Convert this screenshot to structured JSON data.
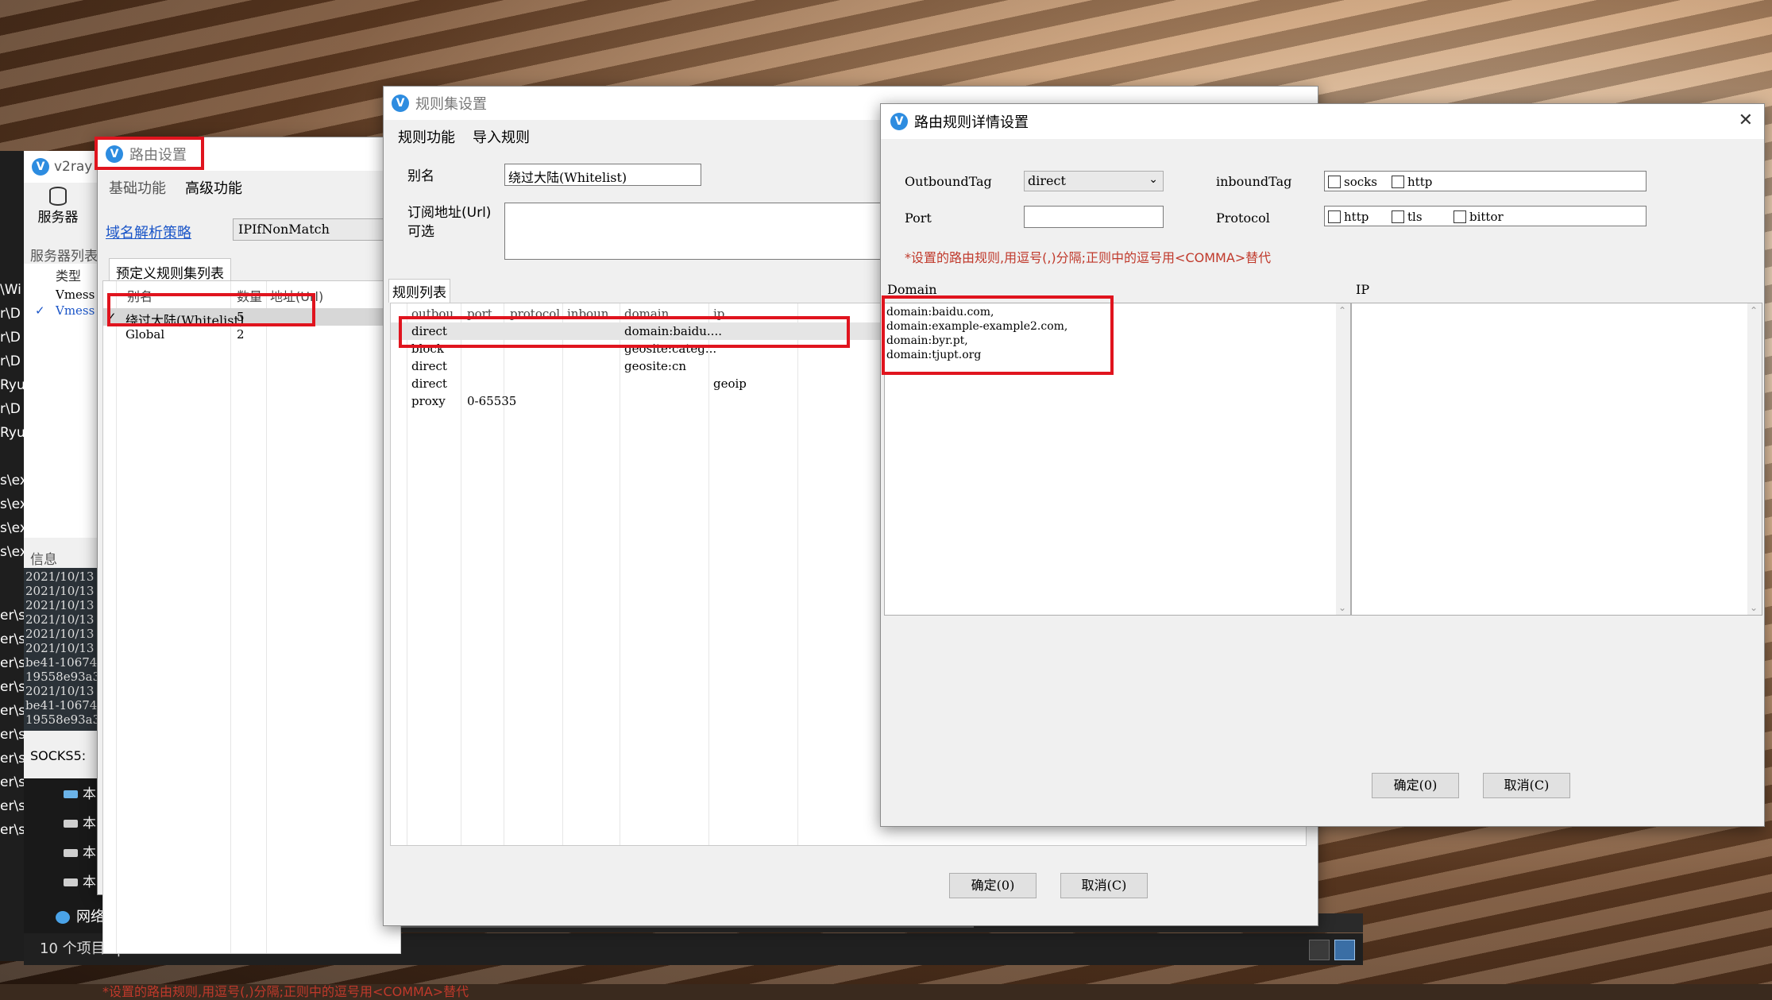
{
  "desktop": {
    "bg": "#3a2a1e"
  },
  "explorer": {
    "left_chars": [
      "\\Wi",
      "r\\D",
      "r\\D",
      "r\\D",
      "Ryu",
      "r\\D",
      "Ryu",
      "",
      "s\\ex",
      "s\\ex",
      "s\\ex",
      "s\\ex",
      "",
      "er\\s",
      "er\\s",
      "er\\s",
      "er\\s",
      "er\\s",
      "er\\s",
      "er\\s",
      "er\\s",
      "er\\s",
      "er\\s"
    ],
    "tree_items": [
      "本",
      "本",
      "本",
      "本"
    ],
    "network_label": "网络",
    "status_count": "10 个项目",
    "status_cursor": "|"
  },
  "v2ray_main": {
    "title": "v2ray",
    "server_button": "服务器",
    "server_list_label": "服务器列表",
    "col_type": "类型",
    "rows": [
      {
        "check": "",
        "type": "Vmess"
      },
      {
        "check": "✓",
        "type": "Vmess"
      }
    ],
    "info_label": "信息",
    "log_lines": [
      "2021/10/13",
      "2021/10/13",
      "2021/10/13",
      "2021/10/13",
      "2021/10/13",
      "2021/10/13",
      "be41-10674",
      "19558e93a3",
      "2021/10/13",
      "be41-10674",
      "19558e93a3"
    ],
    "socks_label": "SOCKS5:"
  },
  "routing": {
    "title": "路由设置",
    "tab_basic": "基础功能",
    "tab_advanced": "高级功能",
    "domain_strategy_link": "域名解析策略",
    "domain_strategy_value": "IPIfNonMatch",
    "preset_list_label": "预定义规则集列表",
    "col_alias": "别名",
    "col_count": "数量",
    "col_url": "地址(Url)",
    "rows": [
      {
        "check": "✓",
        "alias": "绕过大陆(Whitelist)",
        "count": "5"
      },
      {
        "check": "",
        "alias": "Global",
        "count": "2"
      }
    ],
    "note": "*设置的路由规则,用逗号(,)分隔;正则中的逗号用<COMMA>替代"
  },
  "ruleset": {
    "title": "规则集设置",
    "menu_rule": "规则功能",
    "menu_import": "导入规则",
    "alias_label": "别名",
    "alias_value": "绕过大陆(Whitelist)",
    "url_label": "订阅地址(Url)",
    "url_optional": "可选",
    "list_label": "规则列表",
    "columns": [
      "outbou",
      "port",
      "protocol",
      "inboun",
      "domain",
      "ip"
    ],
    "rows": [
      {
        "outbound": "direct",
        "port": "",
        "domain": "domain:baidu....",
        "ip": ""
      },
      {
        "outbound": "block",
        "port": "",
        "domain": "geosite:categ...",
        "ip": ""
      },
      {
        "outbound": "direct",
        "port": "",
        "domain": "geosite:cn",
        "ip": ""
      },
      {
        "outbound": "direct",
        "port": "",
        "domain": "",
        "ip": "geoip"
      },
      {
        "outbound": "proxy",
        "port": "0-65535",
        "domain": "",
        "ip": ""
      }
    ],
    "ok_button": "确定(0)",
    "cancel_button": "取消(C)"
  },
  "detail": {
    "title": "路由规则详情设置",
    "close": "✕",
    "outbound_label": "OutboundTag",
    "outbound_value": "direct",
    "inbound_label": "inboundTag",
    "inbound_options": [
      "socks",
      "http"
    ],
    "port_label": "Port",
    "protocol_label": "Protocol",
    "protocol_options": [
      "http",
      "tls",
      "bittor"
    ],
    "note": "*设置的路由规则,用逗号(,)分隔;正则中的逗号用<COMMA>替代",
    "domain_label": "Domain",
    "ip_label": "IP",
    "domain_lines": [
      "domain:baidu.com,",
      "domain:example-example2.com,",
      "domain:byr.pt,",
      "domain:tjupt.org"
    ],
    "ok_button": "确定(0)",
    "cancel_button": "取消(C)"
  },
  "colors": {
    "accent_red": "#e0141e",
    "note_red": "#c0392b",
    "link_blue": "#1a55c8",
    "icon_blue": "#2d8ce0"
  }
}
